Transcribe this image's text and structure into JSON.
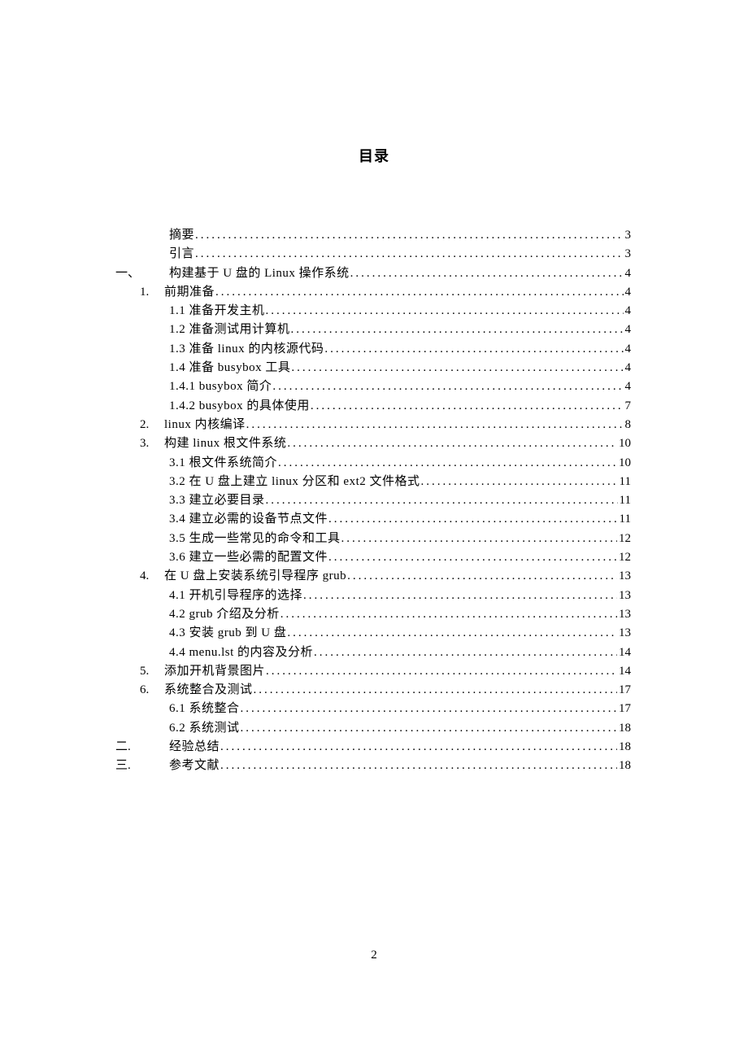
{
  "title": "目录",
  "page_number": "2",
  "toc": [
    {
      "num": "",
      "label": "摘要",
      "page": "3",
      "level": 0,
      "num_visible": false
    },
    {
      "num": "",
      "label": "引言",
      "page": "3",
      "level": 0,
      "num_visible": false
    },
    {
      "num": "一、",
      "label": "构建基于 U 盘的 Linux 操作系统",
      "page": "4",
      "level": 0,
      "num_visible": true
    },
    {
      "num": "1.",
      "label": "前期准备",
      "page": "4",
      "level": 1,
      "num_visible": true
    },
    {
      "num": "",
      "label": "1.1 准备开发主机",
      "page": "4",
      "level": 2,
      "num_visible": false
    },
    {
      "num": "",
      "label": "1.2  准备测试用计算机",
      "page": "4",
      "level": 2,
      "num_visible": false
    },
    {
      "num": "",
      "label": "1.3  准备 linux 的内核源代码",
      "page": "4",
      "level": 2,
      "num_visible": false
    },
    {
      "num": "",
      "label": "1.4  准备 busybox 工具",
      "page": "4",
      "level": 2,
      "num_visible": false
    },
    {
      "num": "",
      "label": "1.4.1  busybox 简介",
      "page": "4",
      "level": 2,
      "num_visible": false
    },
    {
      "num": "",
      "label": "1.4.2  busybox 的具体使用",
      "page": "7",
      "level": 2,
      "num_visible": false
    },
    {
      "num": "2.",
      "label": "linux 内核编译",
      "page": "8",
      "level": 1,
      "num_visible": true
    },
    {
      "num": "3.",
      "label": "构建 linux 根文件系统",
      "page": "10",
      "level": 1,
      "num_visible": true
    },
    {
      "num": "",
      "label": "3.1 根文件系统简介",
      "page": "10",
      "level": 2,
      "num_visible": false
    },
    {
      "num": "",
      "label": "3.2 在 U 盘上建立 linux 分区和 ext2 文件格式",
      "page": "11",
      "level": 2,
      "num_visible": false
    },
    {
      "num": "",
      "label": "3.3  建立必要目录",
      "page": "11",
      "level": 2,
      "num_visible": false
    },
    {
      "num": "",
      "label": "3.4  建立必需的设备节点文件",
      "page": "11",
      "level": 2,
      "num_visible": false
    },
    {
      "num": "",
      "label": "3.5  生成一些常见的命令和工具",
      "page": "12",
      "level": 2,
      "num_visible": false
    },
    {
      "num": "",
      "label": "3.6  建立一些必需的配置文件",
      "page": "12",
      "level": 2,
      "num_visible": false
    },
    {
      "num": "4.",
      "label": "在 U 盘上安装系统引导程序 grub",
      "page": "13",
      "level": 1,
      "num_visible": true
    },
    {
      "num": "",
      "label": "4.1  开机引导程序的选择",
      "page": "13",
      "level": 2,
      "num_visible": false
    },
    {
      "num": "",
      "label": "4.2  grub 介绍及分析",
      "page": "13",
      "level": 2,
      "num_visible": false
    },
    {
      "num": "",
      "label": "4.3  安装 grub 到 U 盘",
      "page": "13",
      "level": 2,
      "num_visible": false
    },
    {
      "num": "",
      "label": "4.4  menu.lst 的内容及分析",
      "page": "14",
      "level": 2,
      "num_visible": false
    },
    {
      "num": "5.",
      "label": "添加开机背景图片",
      "page": "14",
      "level": 1,
      "num_visible": true
    },
    {
      "num": "6.",
      "label": " 系统整合及测试",
      "page": "17",
      "level": 1,
      "num_visible": true
    },
    {
      "num": "",
      "label": "6.1 系统整合",
      "page": "17",
      "level": 2,
      "num_visible": false
    },
    {
      "num": "",
      "label": "6.2  系统测试",
      "page": "18",
      "level": 2,
      "num_visible": false
    },
    {
      "num": "二.",
      "label": "经验总结",
      "page": "18",
      "level": 0,
      "num_visible": true
    },
    {
      "num": "三.",
      "label": "参考文献",
      "page": "18",
      "level": 0,
      "num_visible": true
    }
  ]
}
